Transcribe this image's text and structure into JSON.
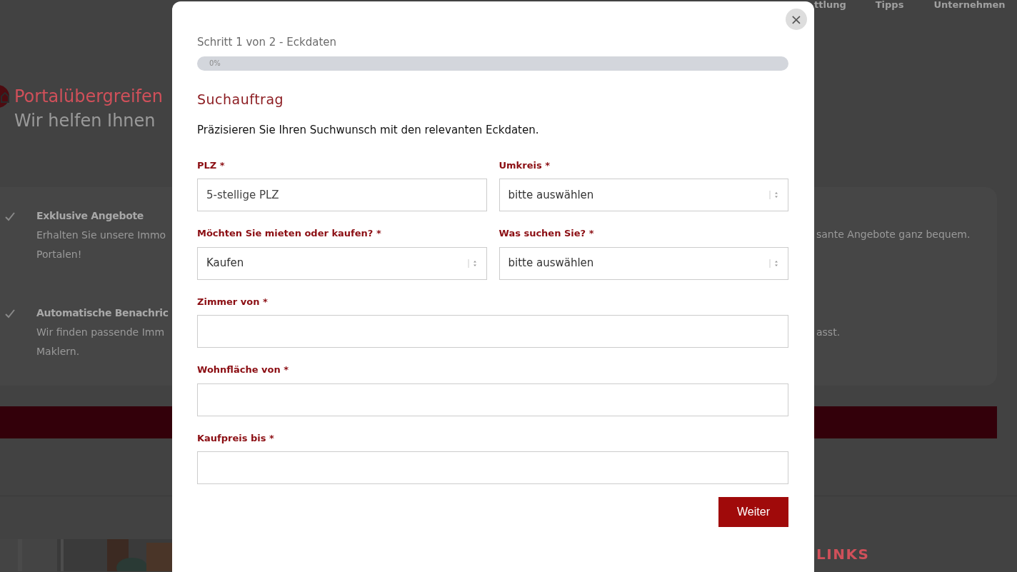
{
  "background_page": {
    "nav_items": [
      "ttlung",
      "Tipps",
      "Unternehmen"
    ],
    "hero_title": "Portalübergreifen",
    "hero_subtitle": "Wir helfen Ihnen",
    "features": [
      {
        "title": "Exklusive Angebote",
        "lines": [
          "Erhalten Sie unsere Immo",
          "Portalen!"
        ]
      },
      {
        "title": "Automatische Benachric",
        "lines": [
          "Wir finden passende Imm",
          "Maklern."
        ]
      }
    ],
    "right_fragments": [
      "sante Angebote ganz bequem.",
      "asst."
    ],
    "footer_heading": "LINKS"
  },
  "modal": {
    "step": "Schritt 1 von 2 - Eckdaten",
    "progress": {
      "level": 0,
      "label": "0%"
    },
    "heading": "Suchauftrag",
    "intro": "Präzisieren Sie Ihren Suchwunsch mit den relevanten Eckdaten.",
    "rows": [
      [
        {
          "label": "PLZ *",
          "kind": "text",
          "placeholder": "5-stellige PLZ"
        },
        {
          "label": "Umkreis *",
          "kind": "select",
          "value": "bitte auswählen"
        }
      ],
      [
        {
          "label": "Möchten Sie mieten oder kaufen? *",
          "kind": "select",
          "value": "Kaufen"
        },
        {
          "label": "Was suchen Sie? *",
          "kind": "select",
          "value": "bitte auswählen"
        }
      ],
      [
        {
          "label": "Zimmer von *",
          "kind": "text"
        }
      ],
      [
        {
          "label": "Wohnfläche von *",
          "kind": "text"
        }
      ],
      [
        {
          "label": "Kaufpreis bis *",
          "kind": "text"
        }
      ]
    ],
    "submit": "Weiter",
    "close": "×"
  }
}
